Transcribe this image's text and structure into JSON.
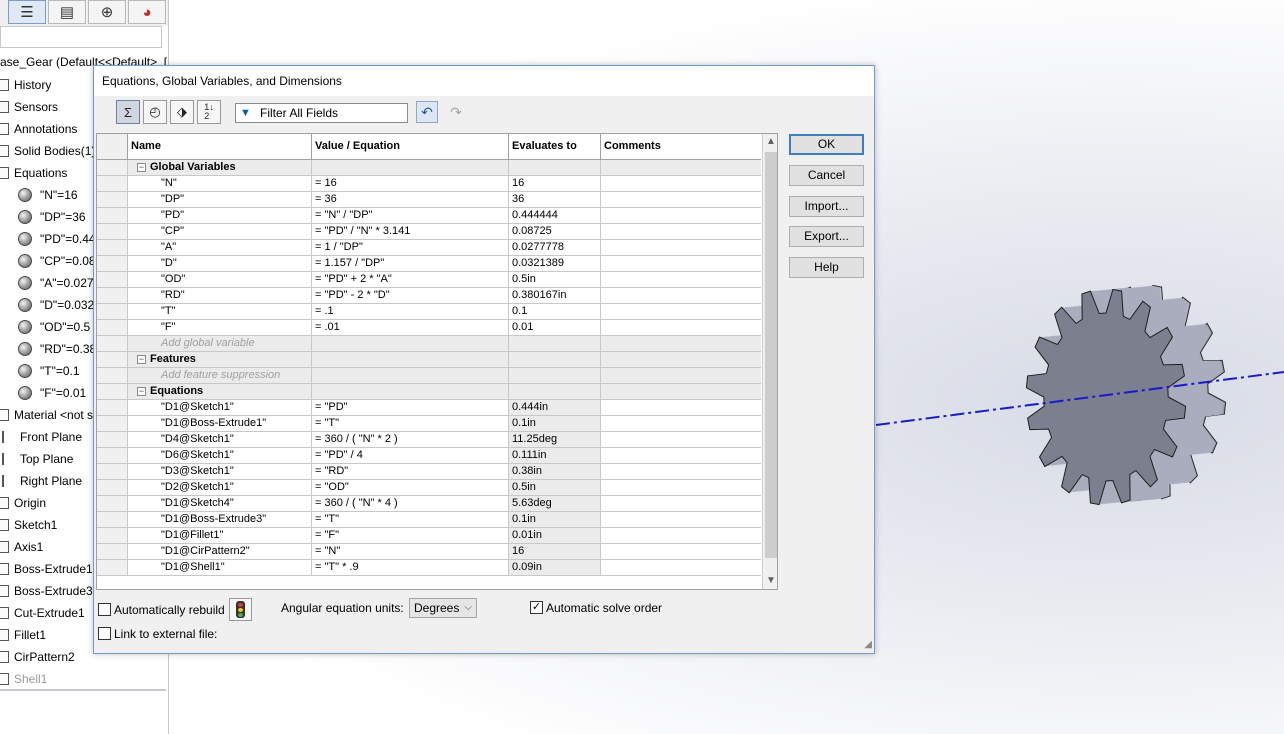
{
  "feature_manager": {
    "part_name": "ase_Gear  (Default<<Default>_[",
    "tree": [
      {
        "label": "History",
        "icon": "history-icon"
      },
      {
        "label": "Sensors",
        "icon": "sensors-icon"
      },
      {
        "label": "Annotations",
        "icon": "annotations-icon"
      },
      {
        "label": "Solid Bodies(1)",
        "icon": "solid-bodies-icon"
      },
      {
        "label": "Equations",
        "icon": "equations-icon"
      },
      {
        "label": "\"N\"=16",
        "icon": "global-variable-icon"
      },
      {
        "label": "\"DP\"=36",
        "icon": "global-variable-icon"
      },
      {
        "label": "\"PD\"=0.44",
        "icon": "global-variable-icon"
      },
      {
        "label": "\"CP\"=0.08",
        "icon": "global-variable-icon"
      },
      {
        "label": "\"A\"=0.027",
        "icon": "global-variable-icon"
      },
      {
        "label": "\"D\"=0.032",
        "icon": "global-variable-icon"
      },
      {
        "label": "\"OD\"=0.5",
        "icon": "global-variable-icon"
      },
      {
        "label": "\"RD\"=0.38",
        "icon": "global-variable-icon"
      },
      {
        "label": "\"T\"=0.1",
        "icon": "global-variable-icon"
      },
      {
        "label": "\"F\"=0.01",
        "icon": "global-variable-icon"
      },
      {
        "label": "Material <not s",
        "icon": "material-icon"
      },
      {
        "label": "Front Plane",
        "icon": "plane-icon"
      },
      {
        "label": "Top Plane",
        "icon": "plane-icon"
      },
      {
        "label": "Right Plane",
        "icon": "plane-icon"
      },
      {
        "label": "Origin",
        "icon": "origin-icon"
      },
      {
        "label": "Sketch1",
        "icon": "sketch-icon"
      },
      {
        "label": "Axis1",
        "icon": "axis-icon"
      },
      {
        "label": "Boss-Extrude1",
        "icon": "extrude-icon"
      },
      {
        "label": "Boss-Extrude3",
        "icon": "extrude-icon"
      },
      {
        "label": "Cut-Extrude1",
        "icon": "cut-extrude-icon"
      },
      {
        "label": "Fillet1",
        "icon": "fillet-icon"
      },
      {
        "label": "CirPattern2",
        "icon": "circular-pattern-icon"
      },
      {
        "label": "Shell1",
        "icon": "shell-icon"
      }
    ]
  },
  "dialog": {
    "title": "Equations, Global Variables, and Dimensions",
    "filter_placeholder": "Filter All Fields",
    "columns": [
      "Name",
      "Value / Equation",
      "Evaluates to",
      "Comments"
    ],
    "sections": {
      "global_variables": "Global Variables",
      "features": "Features",
      "equations": "Equations"
    },
    "add_global_variable": "Add global variable",
    "add_feature_suppression": "Add feature suppression",
    "global_variables": [
      {
        "name": "\"N\"",
        "value": "= 16",
        "evaluates": "16",
        "comment": ""
      },
      {
        "name": "\"DP\"",
        "value": "= 36",
        "evaluates": "36",
        "comment": ""
      },
      {
        "name": "\"PD\"",
        "value": "= \"N\" / \"DP\"",
        "evaluates": "0.444444",
        "comment": ""
      },
      {
        "name": "\"CP\"",
        "value": "= \"PD\" / \"N\" * 3.141",
        "evaluates": "0.08725",
        "comment": ""
      },
      {
        "name": "\"A\"",
        "value": "= 1 / \"DP\"",
        "evaluates": "0.0277778",
        "comment": ""
      },
      {
        "name": "\"D\"",
        "value": "= 1.157 / \"DP\"",
        "evaluates": "0.0321389",
        "comment": ""
      },
      {
        "name": "\"OD\"",
        "value": "= \"PD\" + 2 * \"A\"",
        "evaluates": "0.5in",
        "comment": ""
      },
      {
        "name": "\"RD\"",
        "value": "= \"PD\" - 2 * \"D\"",
        "evaluates": "0.380167in",
        "comment": ""
      },
      {
        "name": "\"T\"",
        "value": "= .1",
        "evaluates": "0.1",
        "comment": ""
      },
      {
        "name": "\"F\"",
        "value": "= .01",
        "evaluates": "0.01",
        "comment": ""
      }
    ],
    "equations": [
      {
        "name": "\"D1@Sketch1\"",
        "value": "= \"PD\"",
        "evaluates": "0.444in",
        "comment": ""
      },
      {
        "name": "\"D1@Boss-Extrude1\"",
        "value": "= \"T\"",
        "evaluates": "0.1in",
        "comment": ""
      },
      {
        "name": "\"D4@Sketch1\"",
        "value": "= 360 / ( \"N\" * 2 )",
        "evaluates": "11.25deg",
        "comment": ""
      },
      {
        "name": "\"D6@Sketch1\"",
        "value": "= \"PD\" / 4",
        "evaluates": "0.111in",
        "comment": ""
      },
      {
        "name": "\"D3@Sketch1\"",
        "value": "= \"RD\"",
        "evaluates": "0.38in",
        "comment": ""
      },
      {
        "name": "\"D2@Sketch1\"",
        "value": "= \"OD\"",
        "evaluates": "0.5in",
        "comment": ""
      },
      {
        "name": "\"D1@Sketch4\"",
        "value": "= 360 / ( \"N\" * 4 )",
        "evaluates": "5.63deg",
        "comment": ""
      },
      {
        "name": "\"D1@Boss-Extrude3\"",
        "value": "= \"T\"",
        "evaluates": "0.1in",
        "comment": ""
      },
      {
        "name": "\"D1@Fillet1\"",
        "value": "= \"F\"",
        "evaluates": "0.01in",
        "comment": ""
      },
      {
        "name": "\"D1@CirPattern2\"",
        "value": "= \"N\"",
        "evaluates": "16",
        "comment": ""
      },
      {
        "name": "\"D1@Shell1\"",
        "value": "= \"T\" * .9",
        "evaluates": "0.09in",
        "comment": ""
      }
    ],
    "buttons": {
      "ok": "OK",
      "cancel": "Cancel",
      "import": "Import...",
      "export": "Export...",
      "help": "Help"
    },
    "bottom": {
      "auto_rebuild_label": "Automatically rebuild",
      "auto_rebuild_checked": false,
      "angular_units_label": "Angular equation units:",
      "angular_units_value": "Degrees",
      "auto_solve_label": "Automatic solve order",
      "auto_solve_checked": true,
      "link_external_label": "Link to external file:",
      "link_external_checked": false
    }
  },
  "colors": {
    "dialog_border": "#6f9bd1",
    "default_button_border": "#3c7fc1",
    "axis_line": "#1a1acc",
    "gear_face": "#7b7f8e",
    "gear_side": "#a9adbd"
  }
}
